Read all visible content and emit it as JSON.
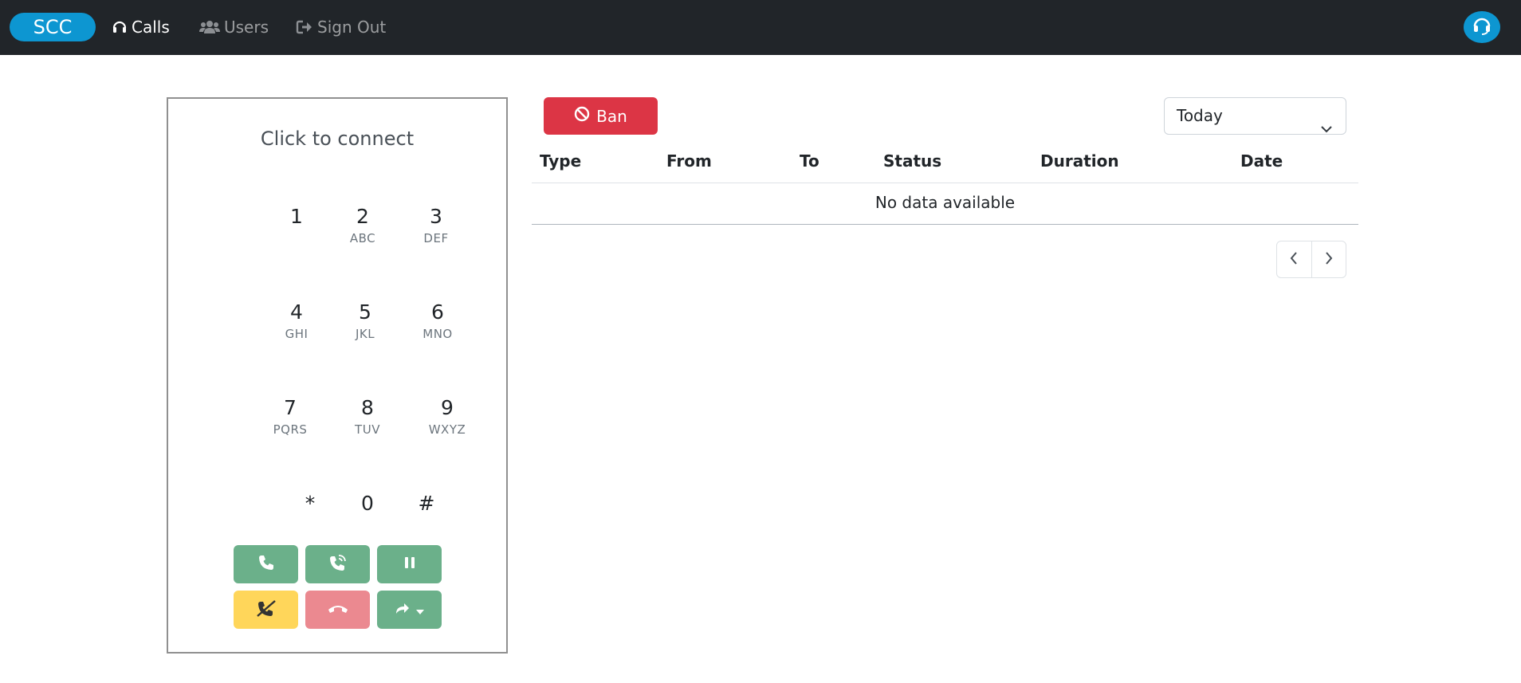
{
  "navbar": {
    "brand": "SCC",
    "links": [
      {
        "label": "Calls",
        "icon": "headset-icon",
        "active": true
      },
      {
        "label": "Users",
        "icon": "users-icon",
        "active": false
      },
      {
        "label": "Sign Out",
        "icon": "sign-out-icon",
        "active": false
      }
    ],
    "avatar_icon": "headset-icon"
  },
  "dialer": {
    "status": "Click to connect",
    "keys": [
      {
        "digit": "1",
        "letters": ""
      },
      {
        "digit": "2",
        "letters": "ABC"
      },
      {
        "digit": "3",
        "letters": "DEF"
      },
      {
        "digit": "4",
        "letters": "GHI"
      },
      {
        "digit": "5",
        "letters": "JKL"
      },
      {
        "digit": "6",
        "letters": "MNO"
      },
      {
        "digit": "7",
        "letters": "PQRS"
      },
      {
        "digit": "8",
        "letters": "TUV"
      },
      {
        "digit": "9",
        "letters": "WXYZ"
      },
      {
        "digit": "*",
        "letters": ""
      },
      {
        "digit": "0",
        "letters": ""
      },
      {
        "digit": "#",
        "letters": ""
      }
    ],
    "controls": [
      {
        "name": "call-button",
        "icon": "phone-icon",
        "color": "#6bb08a"
      },
      {
        "name": "call-wait-button",
        "icon": "phone-volume-icon",
        "color": "#6bb08a"
      },
      {
        "name": "hold-button",
        "icon": "pause-icon",
        "color": "#6bb08a"
      },
      {
        "name": "mute-button",
        "icon": "phone-slash-icon",
        "color": "#ffd65a"
      },
      {
        "name": "hangup-button",
        "icon": "phone-hangup-icon",
        "color": "#eb8990"
      },
      {
        "name": "transfer-button",
        "icon": "share-icon",
        "color": "#6bb08a"
      }
    ]
  },
  "toolbar": {
    "ban_label": "Ban",
    "ban_color": "#dc3545",
    "period_selected": "Today"
  },
  "table": {
    "columns": [
      "Type",
      "From",
      "To",
      "Status",
      "Duration",
      "Date"
    ],
    "empty_text": "No data available"
  },
  "colors": {
    "navbar_bg": "#212529",
    "brand_accent": "#0d96d1"
  }
}
